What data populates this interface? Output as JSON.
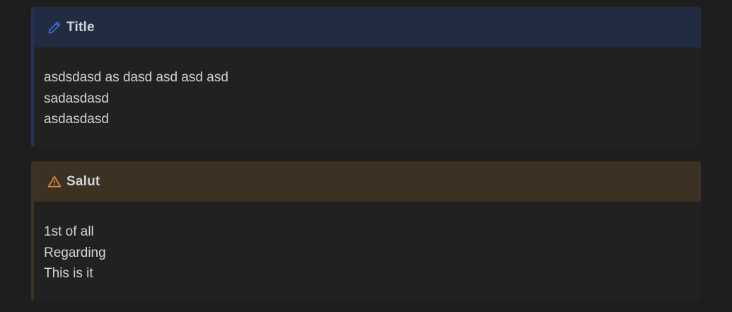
{
  "colors": {
    "background": "#1e1e1e",
    "note_accent": "#3b6fd8",
    "warning_accent": "#e0913a",
    "note_header_bg": "#212c42",
    "warning_header_bg": "#3d3124"
  },
  "callouts": [
    {
      "type": "note",
      "icon": "pencil-icon",
      "title": "Title",
      "lines": [
        "asdsdasd as dasd asd asd asd",
        "sadasdasd",
        "asdasdasd"
      ]
    },
    {
      "type": "warning",
      "icon": "warning-triangle-icon",
      "title": "Salut",
      "lines": [
        "1st of all",
        "Regarding",
        "This is it"
      ]
    }
  ]
}
